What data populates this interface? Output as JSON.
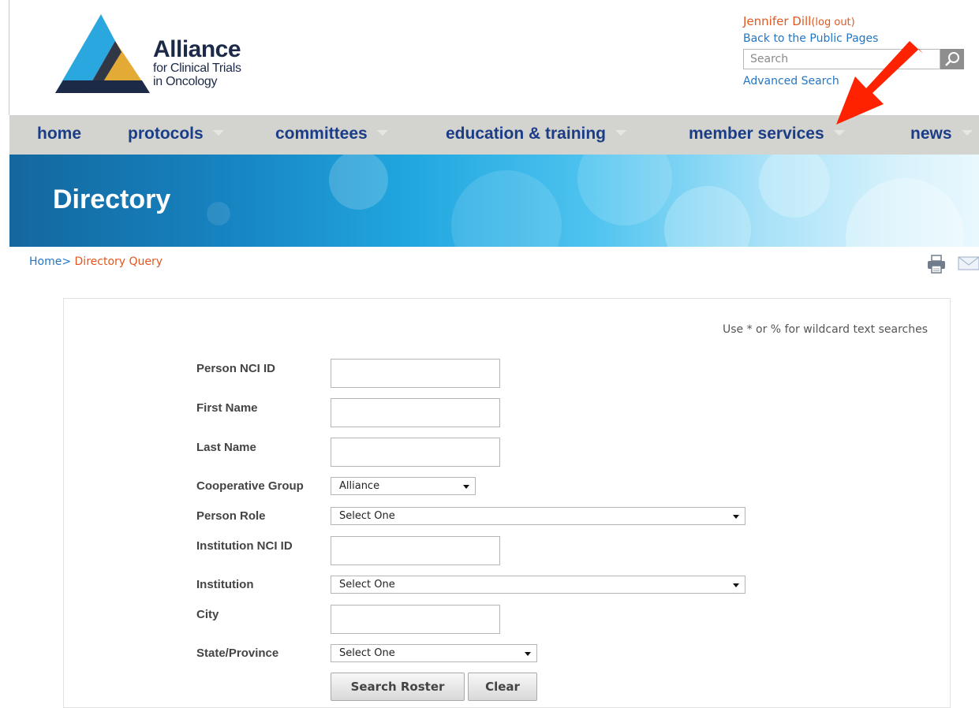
{
  "header": {
    "logo": {
      "name": "Alliance",
      "subtitle_line1": "for Clinical Trials",
      "subtitle_line2": "in Oncology",
      "colors": {
        "blue": "#2aa7df",
        "gold": "#e4aa36",
        "navy": "#1d2a47"
      }
    },
    "user": {
      "name": "Jennifer Dill",
      "logout_label": "(log out)",
      "public_pages_link": "Back to the Public Pages",
      "search_placeholder": "Search",
      "search_icon": "magnifier-icon",
      "advanced_search_link": "Advanced Search"
    },
    "annotation": {
      "icon": "red-arrow-pointer",
      "color": "#ff2200"
    }
  },
  "nav": {
    "items": [
      {
        "label": "home",
        "has_dropdown": false
      },
      {
        "label": "protocols",
        "has_dropdown": true
      },
      {
        "label": "committees",
        "has_dropdown": true
      },
      {
        "label": "education & training",
        "has_dropdown": true
      },
      {
        "label": "member services",
        "has_dropdown": true
      },
      {
        "label": "news",
        "has_dropdown": true
      }
    ]
  },
  "banner": {
    "title": "Directory"
  },
  "breadcrumb": {
    "home": "Home",
    "separator": "> ",
    "current": "Directory Query"
  },
  "tools": {
    "print_icon": "printer-icon",
    "email_icon": "envelope-icon"
  },
  "form": {
    "hint": "Use * or % for wildcard text searches",
    "fields": {
      "person_nci_id": {
        "label": "Person NCI ID",
        "value": ""
      },
      "first_name": {
        "label": "First Name",
        "value": ""
      },
      "last_name": {
        "label": "Last Name",
        "value": ""
      },
      "cooperative_group": {
        "label": "Cooperative Group",
        "selected": "Alliance"
      },
      "person_role": {
        "label": "Person Role",
        "selected": "Select One"
      },
      "institution_nci_id": {
        "label": "Institution NCI ID",
        "value": ""
      },
      "institution": {
        "label": "Institution",
        "selected": "Select One"
      },
      "city": {
        "label": "City",
        "value": ""
      },
      "state_province": {
        "label": "State/Province",
        "selected": "Select One"
      }
    },
    "buttons": {
      "search": "Search Roster",
      "clear": "Clear"
    }
  },
  "colors": {
    "link_blue": "#2476c2",
    "accent_orange": "#e2571f",
    "nav_text": "#1b3d87",
    "nav_bg": "#d3d4cf"
  }
}
